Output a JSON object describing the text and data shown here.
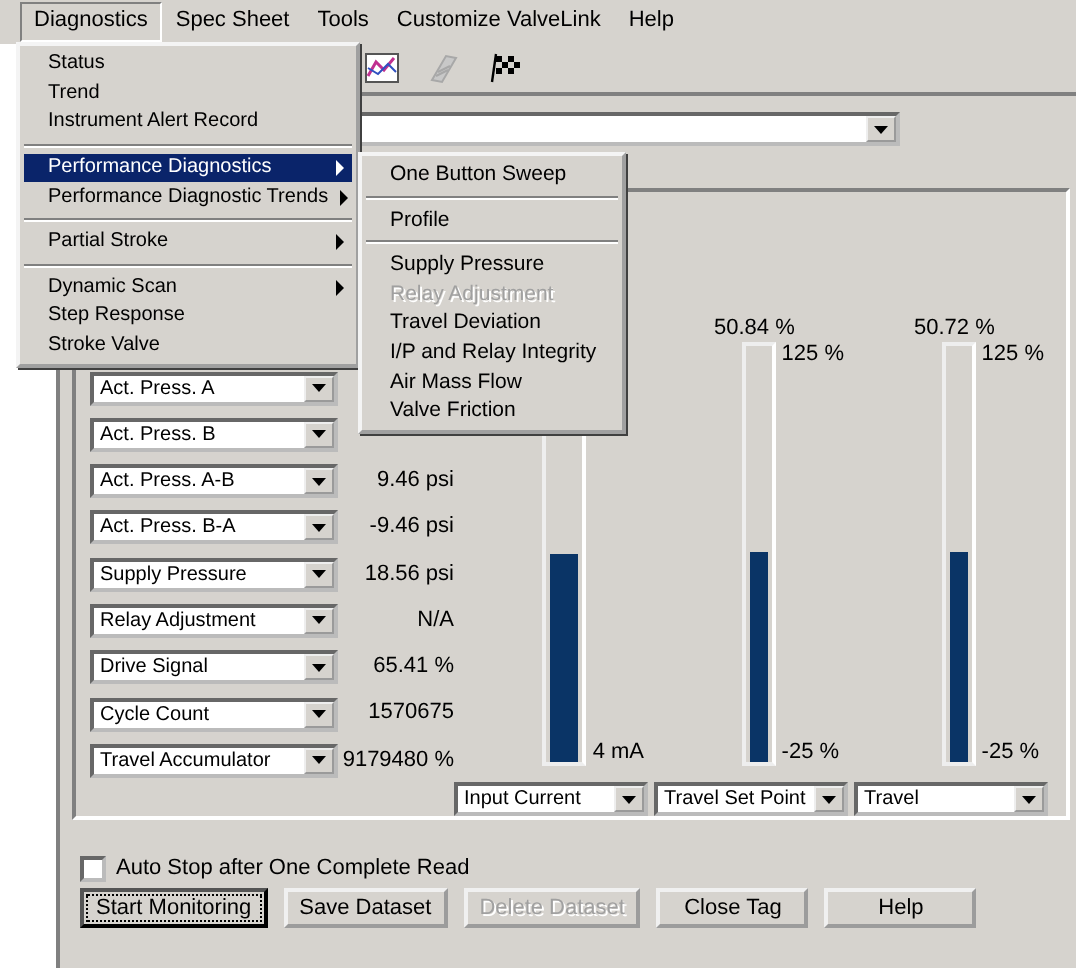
{
  "menubar": [
    {
      "label": "Diagnostics",
      "selected": true
    },
    {
      "label": "Spec Sheet",
      "selected": false
    },
    {
      "label": "Tools",
      "selected": false
    },
    {
      "label": "Customize ValveLink",
      "selected": false
    },
    {
      "label": "Help",
      "selected": false
    }
  ],
  "diagnostics_menu": [
    {
      "kind": "item",
      "label": "Status",
      "submenu": false,
      "selected": false
    },
    {
      "kind": "item",
      "label": "Trend",
      "submenu": false,
      "selected": false
    },
    {
      "kind": "item",
      "label": "Instrument Alert Record",
      "submenu": false,
      "selected": false
    },
    {
      "kind": "separator"
    },
    {
      "kind": "item",
      "label": "Performance Diagnostics",
      "submenu": true,
      "selected": true
    },
    {
      "kind": "item",
      "label": "Performance Diagnostic Trends",
      "submenu": true,
      "selected": false
    },
    {
      "kind": "separator"
    },
    {
      "kind": "item",
      "label": "Partial Stroke",
      "submenu": true,
      "selected": false
    },
    {
      "kind": "separator"
    },
    {
      "kind": "item",
      "label": "Dynamic Scan",
      "submenu": true,
      "selected": false
    },
    {
      "kind": "item",
      "label": "Step Response",
      "submenu": false,
      "selected": false
    },
    {
      "kind": "item",
      "label": "Stroke Valve",
      "submenu": false,
      "selected": false
    }
  ],
  "performance_diagnostics_submenu": [
    {
      "kind": "item",
      "label": "One Button Sweep",
      "disabled": false
    },
    {
      "kind": "separator"
    },
    {
      "kind": "item",
      "label": "Profile",
      "disabled": false
    },
    {
      "kind": "separator"
    },
    {
      "kind": "item",
      "label": "Supply Pressure",
      "disabled": false
    },
    {
      "kind": "item",
      "label": "Relay Adjustment",
      "disabled": true
    },
    {
      "kind": "item",
      "label": "Travel Deviation",
      "disabled": false
    },
    {
      "kind": "item",
      "label": "I/P and Relay Integrity",
      "disabled": false
    },
    {
      "kind": "item",
      "label": "Air Mass Flow",
      "disabled": false
    },
    {
      "kind": "item",
      "label": "Valve Friction",
      "disabled": false
    }
  ],
  "readings": [
    {
      "parameter": "Act. Press. A"
    },
    {
      "parameter": "Act. Press. B"
    },
    {
      "parameter": "Act. Press. A-B",
      "value": "9.46 psi"
    },
    {
      "parameter": "Act. Press. B-A",
      "value": "-9.46 psi"
    },
    {
      "parameter": "Supply Pressure",
      "value": "18.56 psi"
    },
    {
      "parameter": "Relay Adjustment",
      "value": "N/A"
    },
    {
      "parameter": "Drive Signal",
      "value": "65.41 %"
    },
    {
      "parameter": "Cycle Count",
      "value": "1570675"
    },
    {
      "parameter": "Travel Accumulator",
      "value": "9179480 %"
    }
  ],
  "bars": [
    {
      "min_label": "4 mA",
      "level": 0.5,
      "selector": "Input Current"
    },
    {
      "reading": "50.84 %",
      "max_label": "125 %",
      "min_label": "-25 %",
      "level": 0.506,
      "selector": "Travel Set Point"
    },
    {
      "reading": "50.72 %",
      "max_label": "125 %",
      "min_label": "-25 %",
      "level": 0.505,
      "selector": "Travel"
    }
  ],
  "auto_stop": {
    "label": "Auto Stop after One Complete Read",
    "checked": false
  },
  "buttons": [
    {
      "label": "Start Monitoring",
      "disabled": false,
      "focused": true
    },
    {
      "label": "Save Dataset",
      "disabled": false,
      "focused": false
    },
    {
      "label": "Delete Dataset",
      "disabled": true,
      "focused": false
    },
    {
      "label": "Close Tag",
      "disabled": false,
      "focused": false
    },
    {
      "label": "Help",
      "disabled": false,
      "focused": false
    }
  ]
}
